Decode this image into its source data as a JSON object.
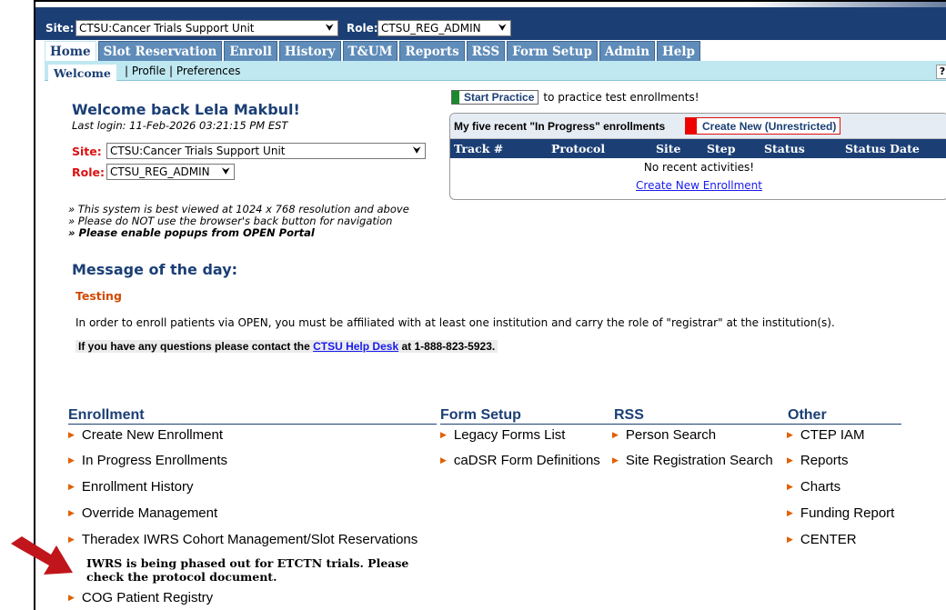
{
  "topbar": {
    "site_label": "Site:",
    "site_value": "CTSU:Cancer Trials Support Unit",
    "role_label": "Role:",
    "role_value": "CTSU_REG_ADMIN"
  },
  "tabs": [
    {
      "label": "Home",
      "active": true
    },
    {
      "label": "Slot Reservation"
    },
    {
      "label": "Enroll"
    },
    {
      "label": "History"
    },
    {
      "label": "T&UM"
    },
    {
      "label": "Reports"
    },
    {
      "label": "RSS"
    },
    {
      "label": "Form Setup"
    },
    {
      "label": "Admin"
    },
    {
      "label": "Help"
    }
  ],
  "subnav": {
    "active": "Welcome",
    "links": "| Profile | Preferences",
    "help": "?"
  },
  "welcome": {
    "title": "Welcome back Lela Makbul!",
    "last_login": "Last login: 11-Feb-2026 03:21:15 PM EST",
    "site_label": "Site:",
    "site_value": "CTSU:Cancer Trials Support Unit",
    "role_label": "Role:",
    "role_value": "CTSU_REG_ADMIN"
  },
  "notes": {
    "line1": "» This system is best viewed at 1024 x 768 resolution and above",
    "line2": "» Please do NOT use the browser's back button for navigation",
    "line3": "» Please enable popups from OPEN Portal"
  },
  "practice": {
    "button": "Start Practice",
    "text": "to practice test enrollments!"
  },
  "recent": {
    "title": "My five recent \"In Progress\" enrollments",
    "create_unrestricted": "Create New (Unrestricted)",
    "columns": [
      "Track #",
      "Protocol",
      "Site",
      "Step",
      "Status",
      "Status Date"
    ],
    "empty": "No recent activities!",
    "create_link": "Create New Enrollment"
  },
  "motd": {
    "title": "Message of the day:",
    "testing": "Testing",
    "message": "In order to enroll patients via OPEN, you must be affiliated with at least one institution and carry the role of \"registrar\" at the institution(s).",
    "questions_pre": "If you have any questions please contact the",
    "questions_link": "CTSU Help Desk",
    "questions_post": "at 1-888-823-5923."
  },
  "sections": {
    "enrollment": {
      "title": "Enrollment",
      "items": [
        "Create New Enrollment",
        "In Progress Enrollments",
        "Enrollment History",
        "Override Management",
        "Theradex IWRS Cohort Management/Slot Reservations",
        "COG Patient Registry"
      ]
    },
    "form_setup": {
      "title": "Form Setup",
      "items": [
        "Legacy Forms List",
        "caDSR Form Definitions"
      ]
    },
    "rss": {
      "title": "RSS",
      "items": [
        "Person Search",
        "Site Registration Search"
      ]
    },
    "other": {
      "title": "Other",
      "items": [
        "CTEP IAM",
        "Reports",
        "Charts",
        "Funding Report",
        "CENTER"
      ]
    }
  },
  "iwrs_note": {
    "line1": "IWRS is being phased out for ETCTN trials. Please",
    "line2": "check the protocol document."
  },
  "colors": {
    "navy": "#1b3f75",
    "tab_blue": "#5f8cb9",
    "subbar": "#bfe8f1",
    "red": "#d11",
    "arrow_red": "#c0161b"
  }
}
